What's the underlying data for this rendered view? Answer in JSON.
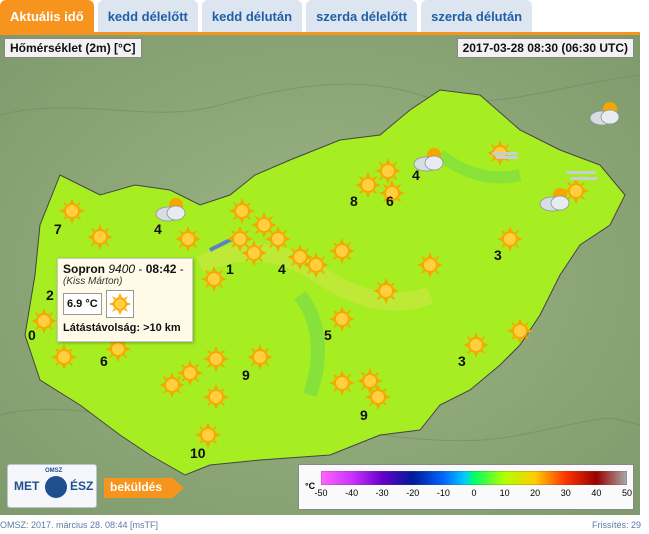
{
  "tabs": [
    {
      "label": "Aktuális idő",
      "active": true
    },
    {
      "label": "kedd délelőtt",
      "active": false
    },
    {
      "label": "kedd délután",
      "active": false
    },
    {
      "label": "szerda délelőtt",
      "active": false
    },
    {
      "label": "szerda délután",
      "active": false
    }
  ],
  "map": {
    "parameter_label": "Hőmérséklet (2m) [°C]",
    "time_label": "2017-03-28 08:30 (06:30 UTC)",
    "wind_values": [
      "7",
      "4",
      "8",
      "6",
      "4",
      "1",
      "4",
      "2",
      "3",
      "0",
      "5",
      "6",
      "9",
      "3",
      "9",
      "10"
    ],
    "sun_icon": "sun-icon",
    "cloud_icon": "partly-cloudy-icon"
  },
  "popup": {
    "station": "Sopron",
    "station_code": "9400",
    "time": "08:42",
    "observer": "(Kiss Márton)",
    "temperature": "6.9 °C",
    "visibility": "Látástávolság: >10 km",
    "weather_icon": "sun-icon"
  },
  "legend": {
    "unit": "°C",
    "ticks": [
      "-50",
      "-40",
      "-30",
      "-20",
      "-10",
      "0",
      "10",
      "20",
      "30",
      "40",
      "50"
    ],
    "colors": [
      "#ff00ff",
      "#9900cc",
      "#2200aa",
      "#0033cc",
      "#00aaff",
      "#00ff66",
      "#ccff00",
      "#ffcc00",
      "#ff3300",
      "#990000",
      "#999999"
    ]
  },
  "logo": {
    "left": "MET",
    "right": "ÉSZ",
    "badge": "OMSZ"
  },
  "submit_label": "beküldés",
  "footer": {
    "left": "OMSZ: 2017. március 28. 08:44 [msTF]",
    "right": "Frissítés: 29"
  },
  "colors": {
    "tab_active": "#f7941d",
    "tab_inactive_bg": "#dde6f0",
    "tab_text": "#1f5fa6",
    "map_fill": "#a6ee22"
  }
}
